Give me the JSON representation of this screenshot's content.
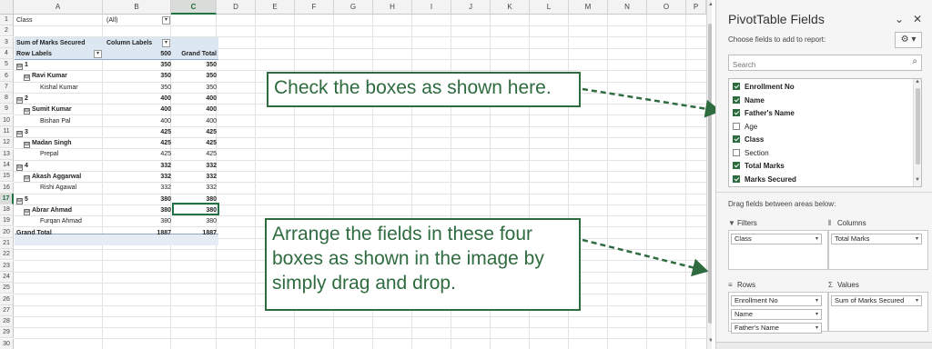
{
  "sheet": {
    "columns": [
      "A",
      "B",
      "C",
      "D",
      "E",
      "F",
      "G",
      "H",
      "I",
      "J",
      "K",
      "L",
      "M",
      "N",
      "O",
      "P"
    ],
    "rows": [
      "1",
      "2",
      "3",
      "4",
      "5",
      "6",
      "7",
      "8",
      "9",
      "10",
      "11",
      "12",
      "13",
      "14",
      "15",
      "16",
      "17",
      "18",
      "19",
      "20",
      "21",
      "22",
      "23",
      "24",
      "25",
      "26",
      "27",
      "28",
      "29",
      "30",
      "31"
    ],
    "filter": {
      "label": "Class",
      "value": "(All)",
      "dropdown": "▾"
    },
    "header_row": {
      "title": "Sum of Marks Secured",
      "col_labels": "Column Labels",
      "dropdown": "▾"
    },
    "labels_row": {
      "row_labels": "Row Labels",
      "col_500": "500",
      "grand_total": "Grand Total",
      "dropdown": "▾"
    },
    "collapse_symbol": "⊟",
    "pivot_rows": [
      {
        "label": "1",
        "v1": "350",
        "v2": "350",
        "level": 0
      },
      {
        "label": "Ravi Kumar",
        "v1": "350",
        "v2": "350",
        "level": 1
      },
      {
        "label": "Kishal Kumar",
        "v1": "350",
        "v2": "350",
        "level": 2
      },
      {
        "label": "2",
        "v1": "400",
        "v2": "400",
        "level": 0
      },
      {
        "label": "Sumit Kumar",
        "v1": "400",
        "v2": "400",
        "level": 1
      },
      {
        "label": "Bishan Pal",
        "v1": "400",
        "v2": "400",
        "level": 2
      },
      {
        "label": "3",
        "v1": "425",
        "v2": "425",
        "level": 0
      },
      {
        "label": "Madan Singh",
        "v1": "425",
        "v2": "425",
        "level": 1
      },
      {
        "label": "Prepal",
        "v1": "425",
        "v2": "425",
        "level": 2
      },
      {
        "label": "4",
        "v1": "332",
        "v2": "332",
        "level": 0
      },
      {
        "label": "Akash Aggarwal",
        "v1": "332",
        "v2": "332",
        "level": 1
      },
      {
        "label": "Rishi Agawal",
        "v1": "332",
        "v2": "332",
        "level": 2
      },
      {
        "label": "5",
        "v1": "380",
        "v2": "380",
        "level": 0
      },
      {
        "label": "Abrar Ahmad",
        "v1": "380",
        "v2": "380",
        "level": 1
      },
      {
        "label": "Furqan Ahmad",
        "v1": "380",
        "v2": "380",
        "level": 2
      },
      {
        "label": "Grand Total",
        "v1": "1887",
        "v2": "1887",
        "level": 3
      }
    ],
    "selected_column": "C",
    "selected_row": "17"
  },
  "callouts": {
    "check": "Check the boxes as shown here.",
    "arrange": "Arrange the fields in these four boxes as shown in the image by simply drag and drop."
  },
  "pivot_panel": {
    "title": "PivotTable Fields",
    "subtitle": "Choose fields to add to report:",
    "search_placeholder": "Search",
    "fields": [
      {
        "name": "Enrollment No",
        "checked": true
      },
      {
        "name": "Name",
        "checked": true
      },
      {
        "name": "Father's Name",
        "checked": true
      },
      {
        "name": "Age",
        "checked": false
      },
      {
        "name": "Class",
        "checked": true
      },
      {
        "name": "Section",
        "checked": false
      },
      {
        "name": "Total Marks",
        "checked": true
      },
      {
        "name": "Marks Secured",
        "checked": true
      }
    ],
    "drag_text": "Drag fields between areas below:",
    "areas": {
      "filters": {
        "label": "Filters",
        "items": [
          "Class"
        ]
      },
      "columns": {
        "label": "Columns",
        "items": [
          "Total Marks"
        ]
      },
      "rows": {
        "label": "Rows",
        "items": [
          "Enrollment No",
          "Name",
          "Father's Name"
        ]
      },
      "values": {
        "label": "Values",
        "items": [
          "Sum of Marks Secured"
        ]
      }
    },
    "icons": {
      "chevron": "⌄",
      "close": "✕",
      "gear": "⚙ ▾",
      "search": "⌕",
      "filter": "▼",
      "columns": "⫴",
      "rows": "≡",
      "sigma": "Σ",
      "dropdown": "▾"
    },
    "accent": "#2e6b3f"
  }
}
